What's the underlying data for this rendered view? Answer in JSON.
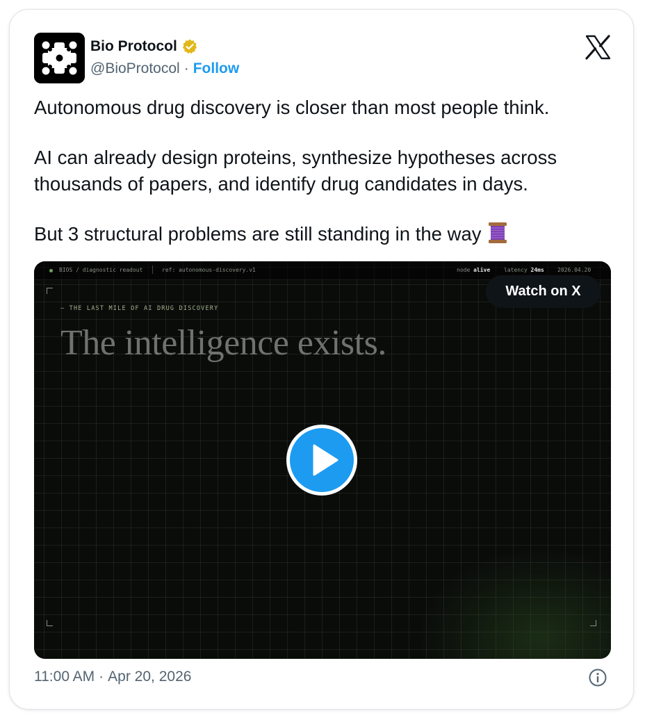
{
  "author": {
    "display_name": "Bio Protocol",
    "handle": "@BioProtocol",
    "separator": "·",
    "follow_label": "Follow",
    "verified_color": "#e2b719",
    "avatar_icon": "bio-protocol-logo-icon"
  },
  "platform": {
    "logo_icon": "x-logo-icon"
  },
  "tweet": {
    "line1": "Autonomous drug discovery is closer than most people think.",
    "line2": "AI can already design proteins, synthesize hypotheses across",
    "line3": "thousands of papers, and identify drug candidates in days.",
    "line4": "But 3 structural problems are still standing in the way",
    "emoji_icon": "thread-spool-icon"
  },
  "video": {
    "topbar": {
      "left": "BIOS / diagnostic readout",
      "ref": "ref: autonomous-discovery.v1",
      "node_label": "node",
      "node_value": "alive",
      "latency_label": "latency",
      "latency_value": "24ms",
      "date": "2026.04.20"
    },
    "kicker": "— THE LAST MILE OF AI DRUG DISCOVERY",
    "headline": "The intelligence exists.",
    "watch_label": "Watch on X",
    "play_icon": "play-icon",
    "accent_color": "#1d9bf0"
  },
  "meta": {
    "time": "11:00 AM",
    "separator": "·",
    "date": "Apr 20, 2026",
    "info_icon": "info-icon"
  },
  "colors": {
    "text_primary": "#0f1419",
    "text_secondary": "#536471",
    "link": "#1d9bf0"
  }
}
